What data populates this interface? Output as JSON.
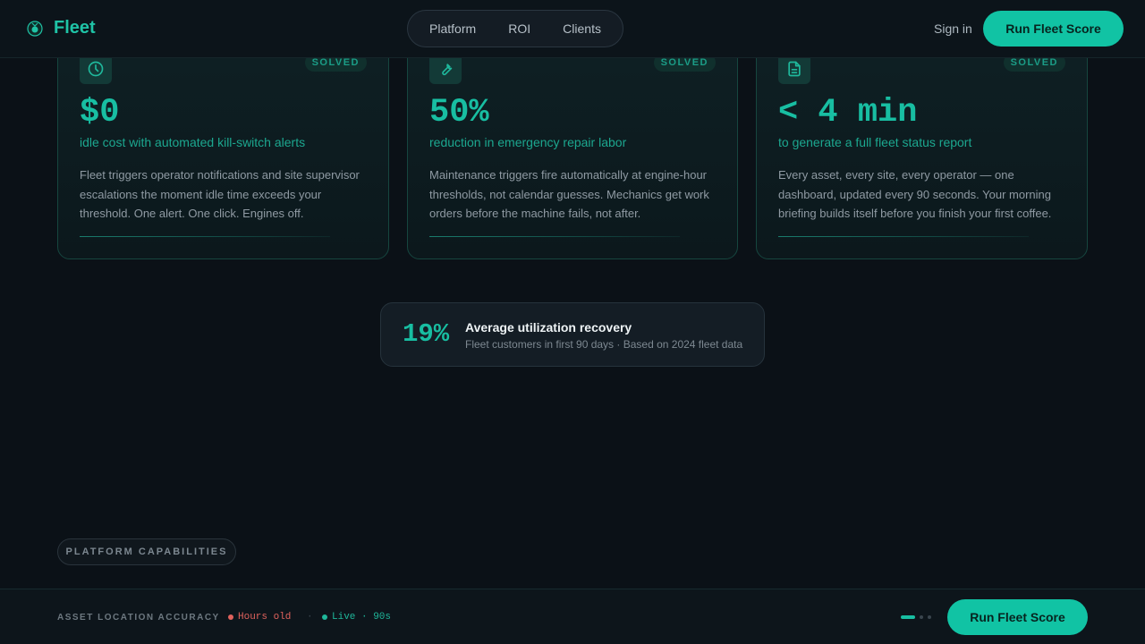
{
  "header": {
    "brand": "Fleet",
    "nav": [
      "Platform",
      "ROI",
      "Clients"
    ],
    "signin": "Sign in",
    "cta": "Run Fleet Score"
  },
  "cards": [
    {
      "icon": "clock-icon",
      "badge": "SOLVED",
      "metric": "$0",
      "metric_sub": "idle cost with automated kill-switch alerts",
      "desc": "Fleet triggers operator notifications and site supervisor escalations the moment idle time exceeds your threshold. One alert. One click. Engines off."
    },
    {
      "icon": "wrench-icon",
      "badge": "SOLVED",
      "metric": "50%",
      "metric_sub": "reduction in emergency repair labor",
      "desc": "Maintenance triggers fire automatically at engine-hour thresholds, not calendar guesses. Mechanics get work orders before the machine fails, not after."
    },
    {
      "icon": "document-icon",
      "badge": "SOLVED",
      "metric": "< 4 min",
      "metric_sub": "to generate a full fleet status report",
      "desc": "Every asset, every site, every operator — one dashboard, updated every 90 seconds. Your morning briefing builds itself before you finish your first coffee."
    }
  ],
  "stat": {
    "value": "19%",
    "title": "Average utilization recovery",
    "subtitle": "Fleet customers in first 90 days · Based on 2024 fleet data"
  },
  "capabilities_label": "PLATFORM CAPABILITIES",
  "footer": {
    "label": "ASSET LOCATION ACCURACY",
    "status_old": "Hours old",
    "separator": "·",
    "status_live": "Live · 90s",
    "cta": "Run Fleet Score"
  },
  "colors": {
    "accent": "#11c3a4",
    "background": "#0b1117",
    "alert": "#e0625d"
  }
}
